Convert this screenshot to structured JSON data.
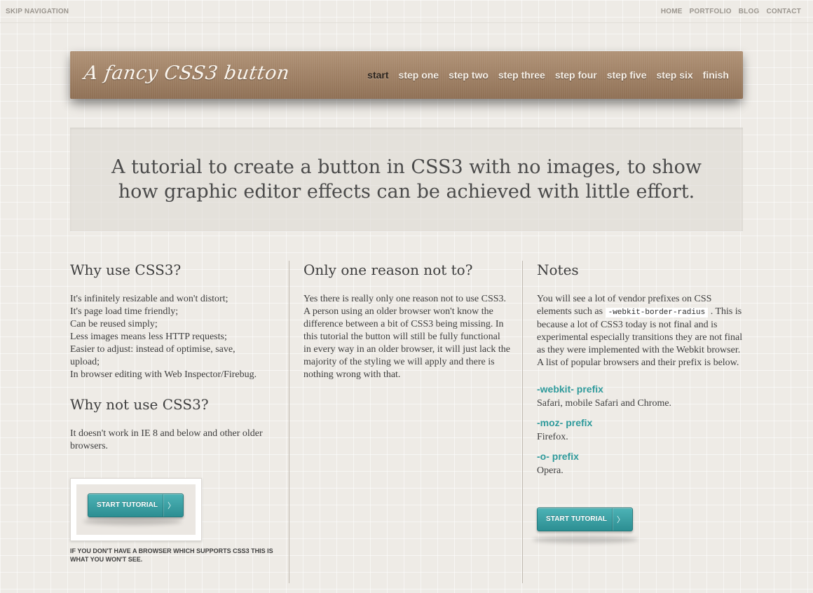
{
  "topbar": {
    "skip": "SKIP NAVIGATION",
    "links": [
      "HOME",
      "PORTFOLIO",
      "BLOG",
      "CONTACT"
    ]
  },
  "header": {
    "logo": "A fancy CSS3 button",
    "nav": [
      "start",
      "step one",
      "step two",
      "step three",
      "step four",
      "step five",
      "step six",
      "finish"
    ],
    "active": "start"
  },
  "intro": {
    "text": "A tutorial to create a button in CSS3 with no images, to show how graphic editor effects can be achieved with little effort."
  },
  "col1": {
    "title1": "Why use CSS3?",
    "lines": [
      "It's infinitely resizable and won't distort;",
      "It's page load time friendly;",
      "Can be reused simply;",
      "Less images means less HTTP requests;",
      "Easier to adjust: instead of optimise, save, upload;",
      "In browser editing with Web Inspector/Firebug."
    ],
    "title2": "Why not use CSS3?",
    "text2": "It doesn't work in IE 8 and below and other older browsers.",
    "button": "START TUTORIAL",
    "caption": "IF YOU DON'T HAVE A BROWSER WHICH SUPPORTS CSS3 THIS IS WHAT YOU WON'T SEE."
  },
  "col2": {
    "title": "Only one reason not to?",
    "text": "Yes there is really only one reason not to use CSS3. A person using an older browser won't know the difference between a bit of CSS3 being missing. In this tutorial the button will still be fully functional in every way in an older browser, it will just lack the majority of the styling we will apply and there is nothing wrong with that."
  },
  "col3": {
    "title": "Notes",
    "text_before": "You will see a lot of vendor prefixes on CSS elements such as",
    "code": "-webkit-border-radius",
    "text_after": ". This is because a lot of CSS3 today is not final and is experimental especially transitions they are not final as they were implemented with the Webkit browser. A list of popular browsers and their prefix is below.",
    "prefixes": [
      {
        "name": "-webkit- prefix",
        "desc": "Safari, mobile Safari and Chrome."
      },
      {
        "name": "-moz- prefix",
        "desc": "Firefox."
      },
      {
        "name": "-o- prefix",
        "desc": "Opera."
      }
    ],
    "button": "START TUTORIAL"
  },
  "colors": {
    "header": "#9f8062",
    "accent": "#2f9a9b",
    "button": "#3ba3a6"
  },
  "icons": {
    "button_arrow": "chevron-right-icon"
  }
}
